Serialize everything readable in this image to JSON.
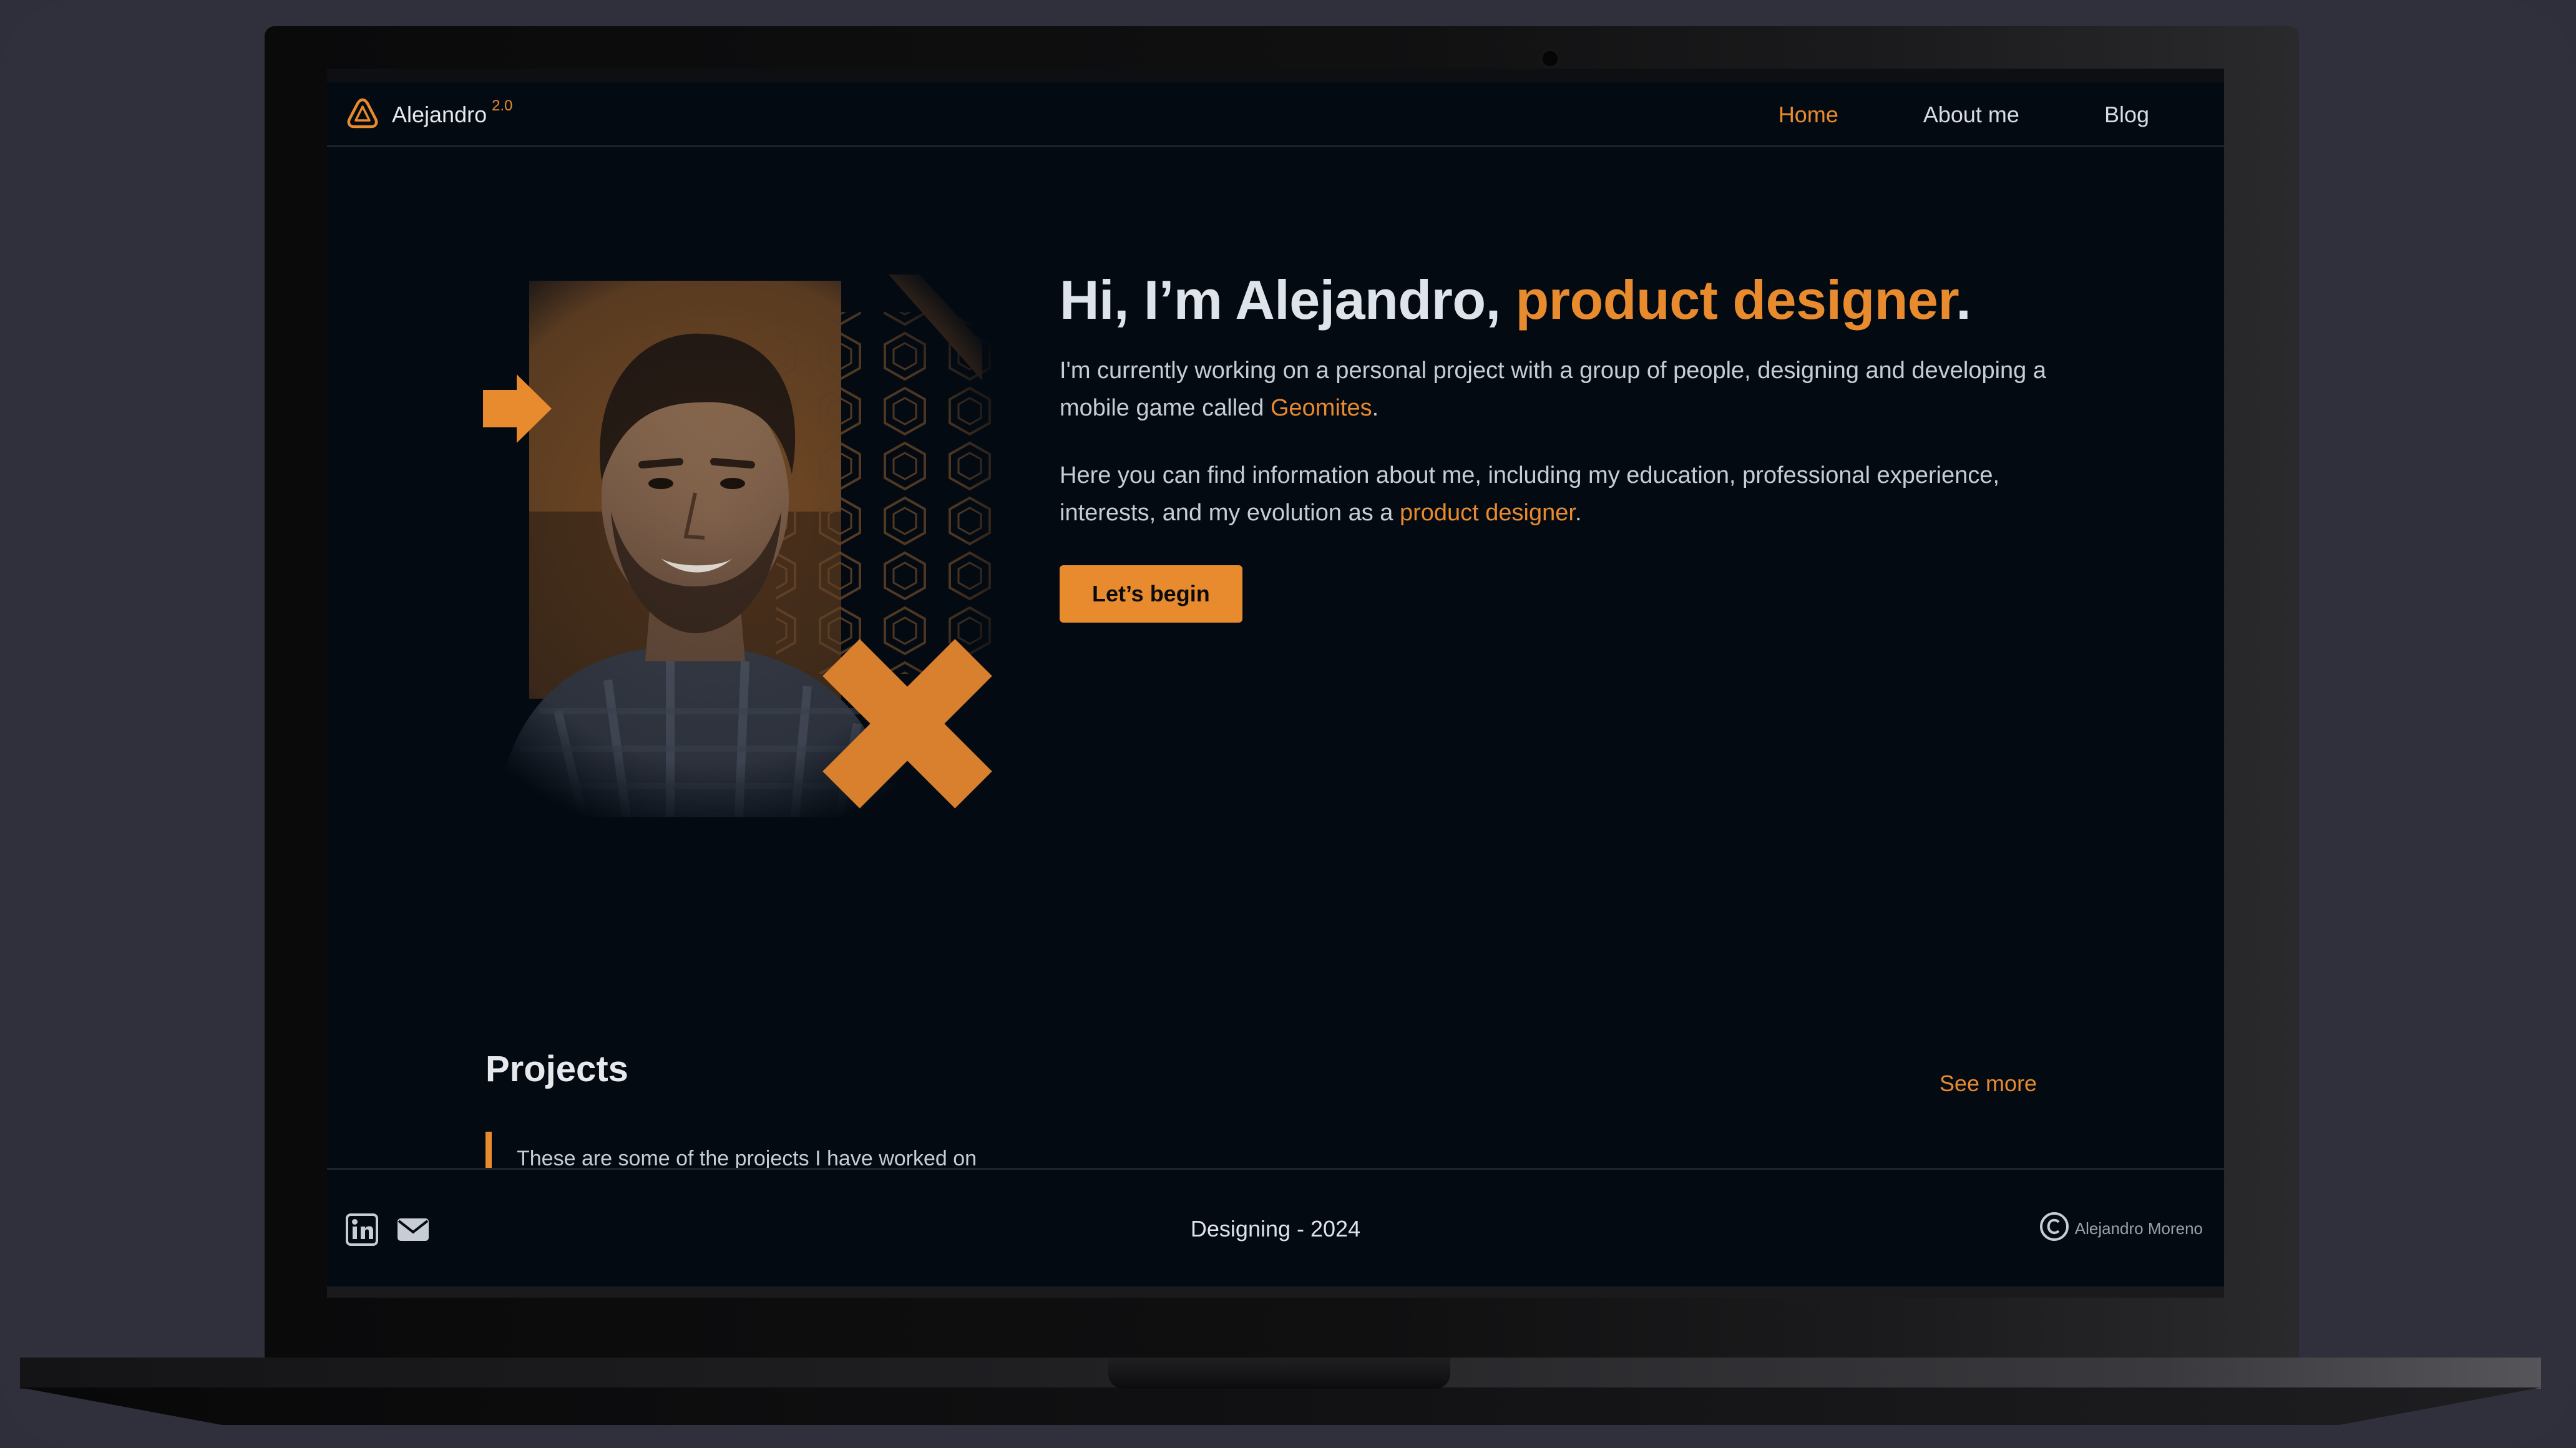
{
  "brand": {
    "name": "Alejandro",
    "version": "2.0",
    "logo_icon": "triangle-logo-icon"
  },
  "nav": {
    "items": [
      {
        "label": "Home",
        "active": true
      },
      {
        "label": "About me",
        "active": false
      },
      {
        "label": "Blog",
        "active": false
      }
    ]
  },
  "hero": {
    "title_plain": "Hi, I’m Alejandro, ",
    "title_accent": "product designer",
    "title_end": ".",
    "p1_before": "I'm currently working on a personal project with a group of people, designing and developing a mobile game called ",
    "p1_link": "Geomites",
    "p1_after": ".",
    "p2_before": "Here you can find information about me, including my education, professional experience, interests, and my evolution as a ",
    "p2_link": "product designer",
    "p2_after": ".",
    "cta_label": "Let’s begin"
  },
  "projects": {
    "title": "Projects",
    "see_more": "See more",
    "description": "These are some of the projects I have worked on"
  },
  "footer": {
    "icons": [
      "linkedin-icon",
      "mail-icon"
    ],
    "center_text": "Designing - 2024",
    "copyright_icon": "copyright-icon",
    "copyright_name": "Alejandro Moreno"
  },
  "colors": {
    "accent": "#e88a2e",
    "background": "#040a12",
    "text": "#dfe3ea",
    "device": "#2f303b"
  }
}
